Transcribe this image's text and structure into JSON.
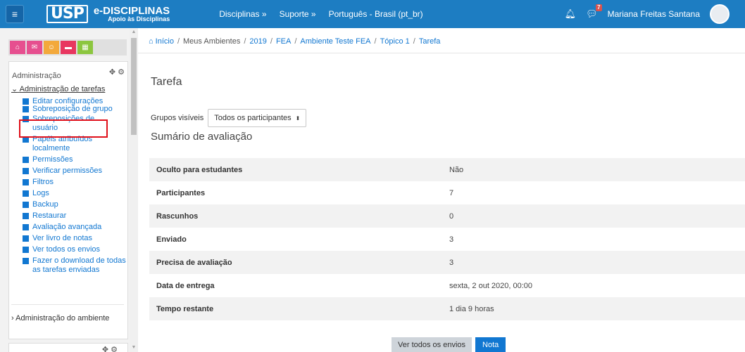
{
  "navbar": {
    "logo_usp": "USP",
    "logo_title": "e-DISCIPLINAS",
    "logo_subtitle": "Apoio às Disciplinas",
    "links": [
      "Disciplinas »",
      "Suporte »",
      "Português - Brasil (pt_br)"
    ],
    "message_count": "7",
    "user_name": "Mariana Freitas Santana"
  },
  "sidebar": {
    "block_title": "Administração",
    "tree_root": "Administração de tarefas",
    "items": [
      "Editar configurações",
      "Sobreposição de grupo",
      "Sobreposições de usuário",
      "Papéis atribuídos localmente",
      "Permissões",
      "Verificar permissões",
      "Filtros",
      "Logs",
      "Backup",
      "Restaurar",
      "Avaliação avançada",
      "Ver livro de notas",
      "Ver todos os envios",
      "Fazer o download de todas as tarefas enviadas"
    ],
    "env_admin": "Administração do ambiente"
  },
  "breadcrumb": [
    "Início",
    "Meus Ambientes",
    "2019",
    "FEA",
    "Ambiente Teste FEA",
    "Tópico 1",
    "Tarefa"
  ],
  "main": {
    "title": "Tarefa",
    "groups_label": "Grupos visíveis",
    "groups_value": "Todos os participantes",
    "summary_title": "Sumário de avaliação",
    "rows": [
      {
        "label": "Oculto para estudantes",
        "value": "Não"
      },
      {
        "label": "Participantes",
        "value": "7"
      },
      {
        "label": "Rascunhos",
        "value": "0"
      },
      {
        "label": "Enviado",
        "value": "3"
      },
      {
        "label": "Precisa de avaliação",
        "value": "3"
      },
      {
        "label": "Data de entrega",
        "value": "sexta, 2 out 2020, 00:00"
      },
      {
        "label": "Tempo restante",
        "value": "1 dia 9 horas"
      }
    ],
    "btn_view_all": "Ver todos os envios",
    "btn_grade": "Nota"
  },
  "colors": {
    "navbar": "#1d7dc2",
    "link": "#1177d1",
    "highlight": "#e0101a"
  }
}
